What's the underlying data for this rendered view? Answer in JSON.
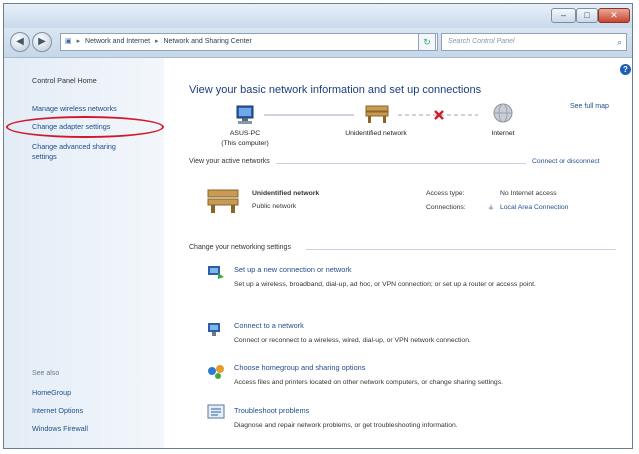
{
  "window": {
    "min_glyph": "–",
    "max_glyph": "□",
    "close_glyph": "✕"
  },
  "address_bar": {
    "path": [
      "Network and Internet",
      "Network and Sharing Center"
    ],
    "search_placeholder": "Search Control Panel"
  },
  "sidebar": {
    "home": "Control Panel Home",
    "links": [
      "Manage wireless networks",
      "Change adapter settings",
      "Change advanced sharing",
      "settings"
    ],
    "see_also_label": "See also",
    "see_also": [
      "HomeGroup",
      "Internet Options",
      "Windows Firewall"
    ]
  },
  "main": {
    "title": "View your basic network information and set up connections",
    "see_full_map": "See full map",
    "map": {
      "computer_name": "ASUS-PC",
      "computer_sub": "(This computer)",
      "network_label": "Unidentified network",
      "internet_label": "Internet"
    },
    "active_networks_label": "View your active networks",
    "connect_disconnect": "Connect or disconnect",
    "network": {
      "name": "Unidentified network",
      "type": "Public network",
      "access_type_label": "Access type:",
      "access_type_value": "No Internet access",
      "connections_label": "Connections:",
      "connections_value": "Local Area Connection"
    },
    "change_settings_label": "Change your networking settings",
    "tasks": [
      {
        "title": "Set up a new connection or network",
        "desc": "Set up a wireless, broadband, dial-up, ad hoc, or VPN connection; or set up a router or access point."
      },
      {
        "title": "Connect to a network",
        "desc": "Connect or reconnect to a wireless, wired, dial-up, or VPN network connection."
      },
      {
        "title": "Choose homegroup and sharing options",
        "desc": "Access files and printers located on other network computers, or change sharing settings."
      },
      {
        "title": "Troubleshoot problems",
        "desc": "Diagnose and repair network problems, or get troubleshooting information."
      }
    ]
  },
  "colors": {
    "accent_link": "#1f4e8c",
    "title_blue": "#1c3f7c",
    "highlight_oval": "#d2192c",
    "error_x": "#d2192c"
  },
  "icons": [
    "back-icon",
    "forward-icon",
    "control-panel-icon",
    "refresh-icon",
    "search-icon",
    "help-icon",
    "computer-icon",
    "bench-network-icon",
    "red-x-icon",
    "globe-icon",
    "new-connection-icon",
    "connect-network-icon",
    "homegroup-icon",
    "troubleshoot-icon"
  ]
}
